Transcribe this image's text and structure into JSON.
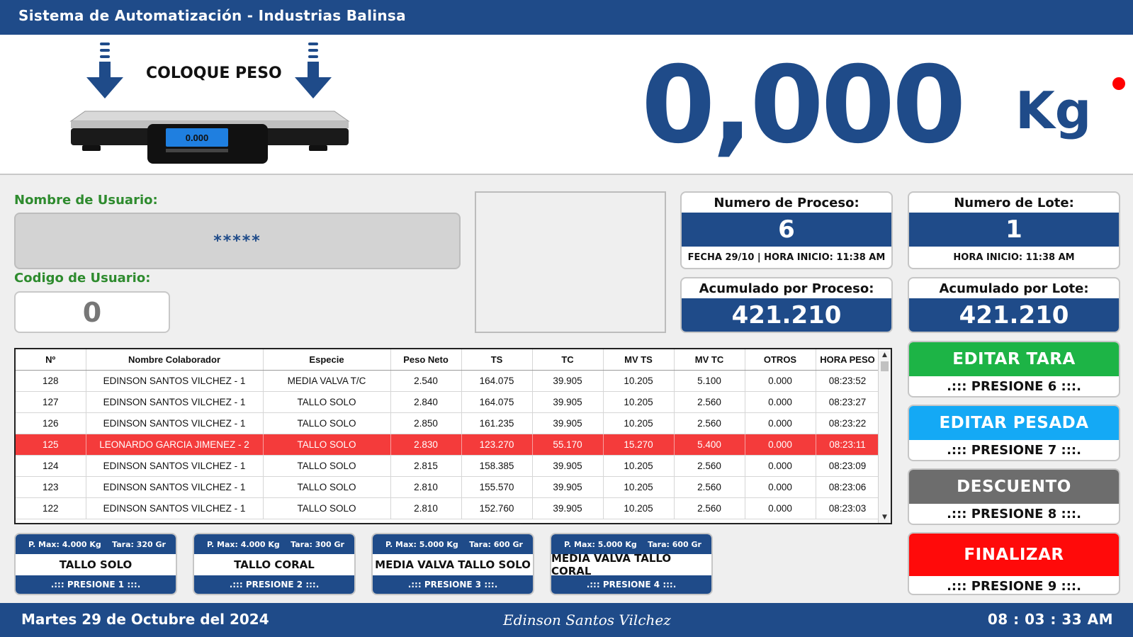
{
  "app": {
    "title": "Sistema de Automatización - Industrias Balinsa"
  },
  "scale": {
    "instruction": "COLOQUE PESO",
    "display": "0.000"
  },
  "weight": {
    "value": "0,000",
    "unit": "Kg",
    "status_color": "#ff0000"
  },
  "user": {
    "name_label": "Nombre de Usuario:",
    "name_value": "*****",
    "code_label": "Codigo de Usuario:",
    "code_value": "0"
  },
  "process": {
    "label": "Numero de Proceso:",
    "value": "6",
    "footer": "FECHA 29/10 | HORA INICIO: 11:38 AM",
    "acc_label": "Acumulado por Proceso:",
    "acc_value": "421.210"
  },
  "lot": {
    "label": "Numero de Lote:",
    "value": "1",
    "footer": "HORA INICIO: 11:38 AM",
    "acc_label": "Acumulado por Lote:",
    "acc_value": "421.210"
  },
  "table": {
    "headers": [
      "Nº",
      "Nombre Colaborador",
      "Especie",
      "Peso Neto",
      "TS",
      "TC",
      "MV TS",
      "MV TC",
      "OTROS",
      "HORA PESO"
    ],
    "rows": [
      [
        "128",
        "EDINSON SANTOS VILCHEZ - 1",
        "MEDIA VALVA T/C",
        "2.540",
        "164.075",
        "39.905",
        "10.205",
        "5.100",
        "0.000",
        "08:23:52"
      ],
      [
        "127",
        "EDINSON SANTOS VILCHEZ - 1",
        "TALLO SOLO",
        "2.840",
        "164.075",
        "39.905",
        "10.205",
        "2.560",
        "0.000",
        "08:23:27"
      ],
      [
        "126",
        "EDINSON SANTOS VILCHEZ - 1",
        "TALLO SOLO",
        "2.850",
        "161.235",
        "39.905",
        "10.205",
        "2.560",
        "0.000",
        "08:23:22"
      ],
      [
        "125",
        "LEONARDO GARCIA JIMENEZ - 2",
        "TALLO SOLO",
        "2.830",
        "123.270",
        "55.170",
        "15.270",
        "5.400",
        "0.000",
        "08:23:11"
      ],
      [
        "124",
        "EDINSON SANTOS VILCHEZ - 1",
        "TALLO SOLO",
        "2.815",
        "158.385",
        "39.905",
        "10.205",
        "2.560",
        "0.000",
        "08:23:09"
      ],
      [
        "123",
        "EDINSON SANTOS VILCHEZ - 1",
        "TALLO SOLO",
        "2.810",
        "155.570",
        "39.905",
        "10.205",
        "2.560",
        "0.000",
        "08:23:06"
      ],
      [
        "122",
        "EDINSON SANTOS VILCHEZ - 1",
        "TALLO SOLO",
        "2.810",
        "152.760",
        "39.905",
        "10.205",
        "2.560",
        "0.000",
        "08:23:03"
      ]
    ],
    "highlight_row_index": 3,
    "highlight_color": "#f43b3b"
  },
  "actions": [
    {
      "label": "EDITAR TARA",
      "hint": ".::: PRESIONE 6 :::.",
      "color": "#1db446"
    },
    {
      "label": "EDITAR PESADA",
      "hint": ".::: PRESIONE 7 :::.",
      "color": "#14a9f5"
    },
    {
      "label": "DESCUENTO",
      "hint": ".::: PRESIONE 8 :::.",
      "color": "#6d6d6d"
    },
    {
      "label": "FINALIZAR",
      "hint": ".::: PRESIONE 9 :::.",
      "color": "#ff0a0a"
    }
  ],
  "species": [
    {
      "pmax": "P. Max: 4.000 Kg",
      "tara": "Tara: 320 Gr",
      "name": "TALLO SOLO",
      "hint": ".::: PRESIONE 1 :::."
    },
    {
      "pmax": "P. Max: 4.000 Kg",
      "tara": "Tara: 300 Gr",
      "name": "TALLO CORAL",
      "hint": ".::: PRESIONE 2 :::."
    },
    {
      "pmax": "P. Max: 5.000 Kg",
      "tara": "Tara: 600 Gr",
      "name": "MEDIA VALVA TALLO SOLO",
      "hint": ".::: PRESIONE 3 :::."
    },
    {
      "pmax": "P. Max: 5.000 Kg",
      "tara": "Tara: 600 Gr",
      "name": "MEDIA VALVA TALLO CORAL",
      "hint": ".::: PRESIONE 4 :::."
    }
  ],
  "footer": {
    "date": "Martes 29 de Octubre del 2024",
    "signature": "Edinson Santos Vilchez",
    "clock": "08 : 03 : 33 AM"
  },
  "colors": {
    "primary": "#1f4b89",
    "label_green": "#2e8b2e"
  }
}
